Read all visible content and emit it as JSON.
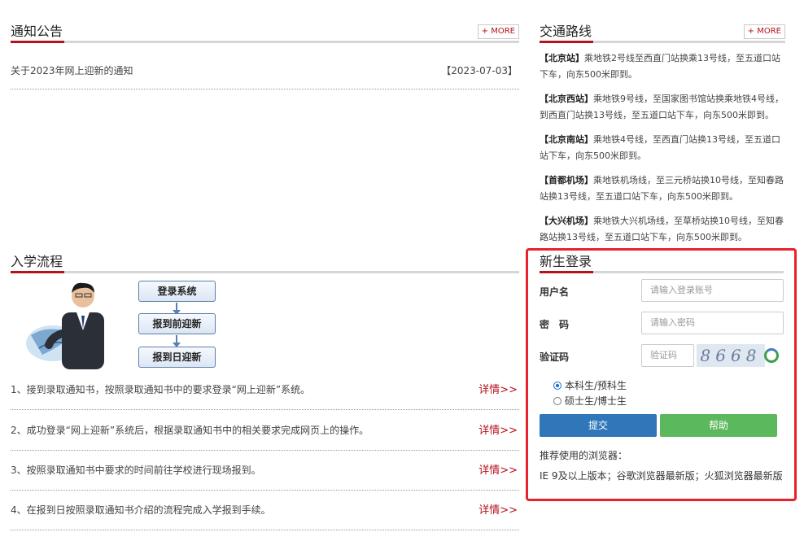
{
  "notice": {
    "title": "通知公告",
    "more": "+ MORE",
    "items": [
      {
        "text": "关于2023年网上迎新的通知",
        "date": "【2023-07-03】"
      }
    ]
  },
  "flow": {
    "title": "入学流程",
    "boxes": [
      "登录系统",
      "报到前迎新",
      "报到日迎新"
    ],
    "steps": [
      {
        "text": "1、接到录取通知书，按照录取通知书中的要求登录“网上迎新”系统。",
        "link": "详情>>"
      },
      {
        "text": "2、成功登录“网上迎新”系统后，根据录取通知书中的相关要求完成网页上的操作。",
        "link": "详情>>"
      },
      {
        "text": "3、按照录取通知书中要求的时间前往学校进行现场报到。",
        "link": "详情>>"
      },
      {
        "text": "4、在报到日按照录取通知书介绍的流程完成入学报到手续。",
        "link": "详情>>"
      }
    ]
  },
  "traffic": {
    "title": "交通路线",
    "more": "+ MORE",
    "routes": [
      {
        "station": "【北京站】",
        "desc": "乘地铁2号线至西直门站换乘13号线，至五道口站下车，向东500米即到。"
      },
      {
        "station": "【北京西站】",
        "desc": "乘地铁9号线，至国家图书馆站换乘地铁4号线，到西直门站换13号线，至五道口站下车，向东500米即到。"
      },
      {
        "station": "【北京南站】",
        "desc": "乘地铁4号线，至西直门站换13号线，至五道口站下车，向东500米即到。"
      },
      {
        "station": "【首都机场】",
        "desc": "乘地铁机场线，至三元桥站换10号线，至知春路站换13号线，至五道口站下车，向东500米即到。"
      },
      {
        "station": "【大兴机场】",
        "desc": "乘地铁大兴机场线，至草桥站换10号线，至知春路站换13号线，至五道口站下车，向东500米即到。"
      }
    ]
  },
  "login": {
    "title": "新生登录",
    "username_label": "用户名",
    "username_placeholder": "请输入登录账号",
    "password_label": "密　码",
    "password_placeholder": "请输入密码",
    "captcha_label": "验证码",
    "captcha_placeholder": "验证码",
    "captcha_text": "8668",
    "options": [
      {
        "label": "本科生/预科生",
        "checked": true
      },
      {
        "label": "硕士生/博士生",
        "checked": false
      }
    ],
    "submit": "提交",
    "help": "帮助",
    "browser_note": "推荐使用的浏览器：",
    "browser_list": "IE 9及以上版本；谷歌浏览器最新版；火狐浏览器最新版"
  },
  "colors": {
    "accent": "#b5121b",
    "highlight_frame": "#e8222a",
    "submit": "#3077b9",
    "help": "#5cb85c"
  }
}
